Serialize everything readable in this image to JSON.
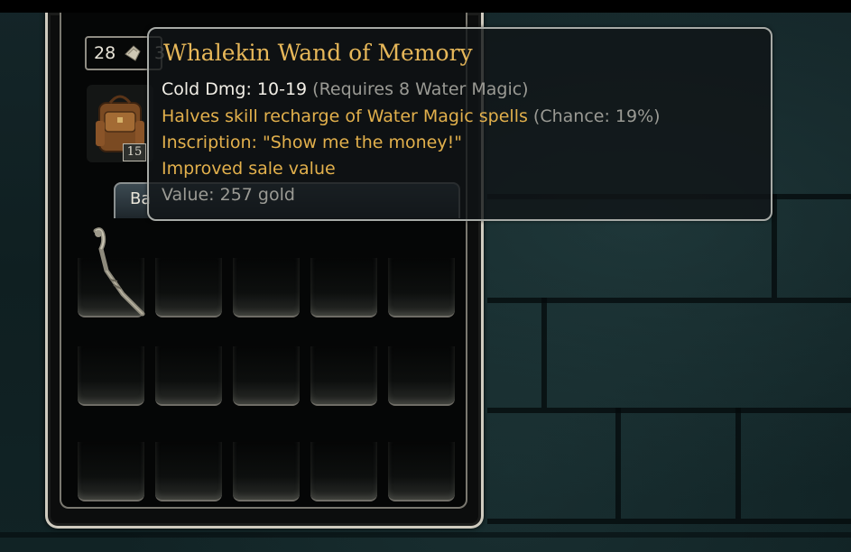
{
  "inventory": {
    "money": "28",
    "money_icon": "coin-sack-icon",
    "money_digit_partial": "3",
    "bag_count": "15",
    "bag_icon": "backpack-icon",
    "bag_tab_label_partial": "Ba",
    "slots": {
      "rows": 3,
      "cols": 5,
      "occupied": [
        {
          "row": 0,
          "col": 0,
          "icon": "wand-icon"
        }
      ]
    }
  },
  "tooltip": {
    "title": "Whalekin Wand of Memory",
    "damage_label": "Cold Dmg: 10-19",
    "damage_requirement": "(Requires 8 Water Magic)",
    "mod_recharge": "Halves skill recharge of Water Magic spells",
    "mod_recharge_chance": "(Chance: 19%)",
    "inscription": "Inscription: \"Show me the money!\"",
    "sale_mod": "Improved sale value",
    "value": "Value: 257 gold"
  },
  "colors": {
    "title_gold": "#e6b759",
    "mod_gold": "#e2b04c",
    "text_white": "#f1eee6",
    "text_grey": "#9a9a94",
    "panel_border": "#cfcbbf",
    "background": "#142528"
  }
}
